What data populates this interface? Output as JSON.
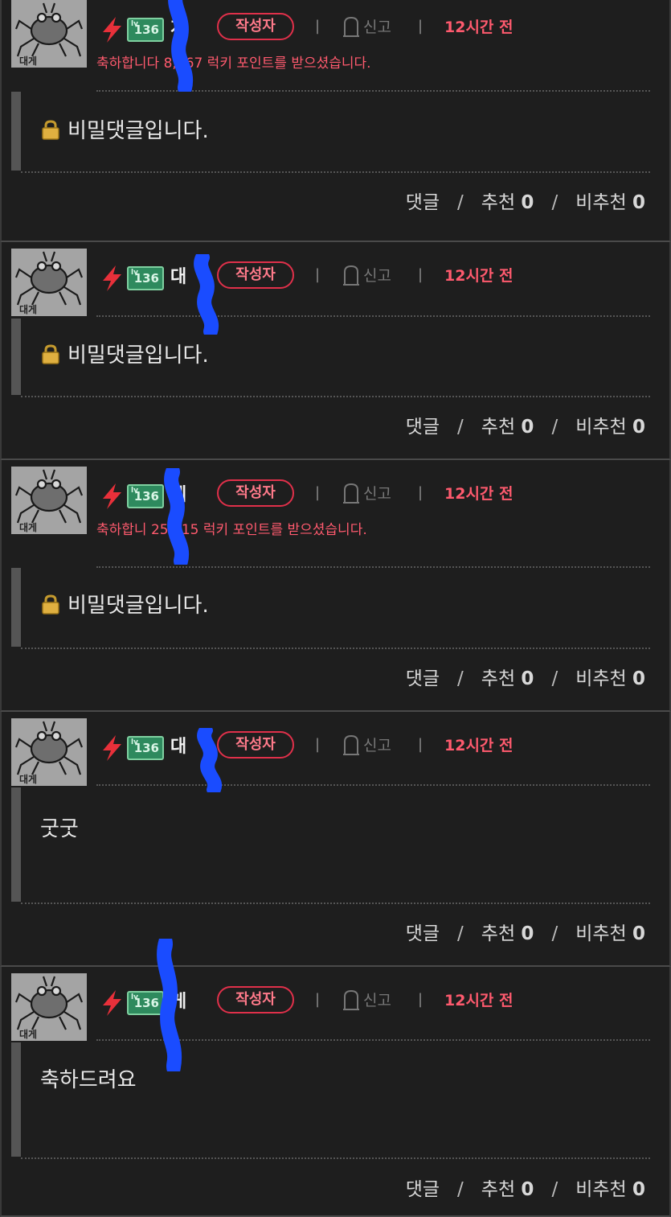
{
  "labels": {
    "author_badge": "작성자",
    "report": "신고",
    "time": "12시간 전",
    "reply": "댓글",
    "like": "추천",
    "dislike": "비추천",
    "level": "136",
    "level_tag": "lv"
  },
  "colors": {
    "background": "#1e1e1e",
    "accent_red": "#ff5a6e",
    "badge_border": "#e0304a",
    "level_badge": "#2e8a5e",
    "redaction": "#1a4cff"
  },
  "icons": {
    "bolt": "lightning-bolt-icon",
    "report": "tombstone-report-icon",
    "lock": "padlock-icon"
  },
  "comments": [
    {
      "nickname": "게",
      "lucky": "축하합니다 8,467 럭키 포인트를 받으셨습니다.",
      "secret": true,
      "text": "비밀댓글입니다.",
      "likes": "0",
      "dislikes": "0"
    },
    {
      "nickname": "대",
      "lucky": "",
      "secret": true,
      "text": "비밀댓글입니다.",
      "likes": "0",
      "dislikes": "0"
    },
    {
      "nickname": "게",
      "lucky": "축하합니 25,915 럭키 포인트를 받으셨습니다.",
      "secret": true,
      "text": "비밀댓글입니다.",
      "likes": "0",
      "dislikes": "0"
    },
    {
      "nickname": "대",
      "lucky": "",
      "secret": false,
      "text": "굿굿",
      "likes": "0",
      "dislikes": "0"
    },
    {
      "nickname": "게",
      "lucky": "",
      "secret": false,
      "text": "축하드려요",
      "likes": "0",
      "dislikes": "0"
    }
  ]
}
